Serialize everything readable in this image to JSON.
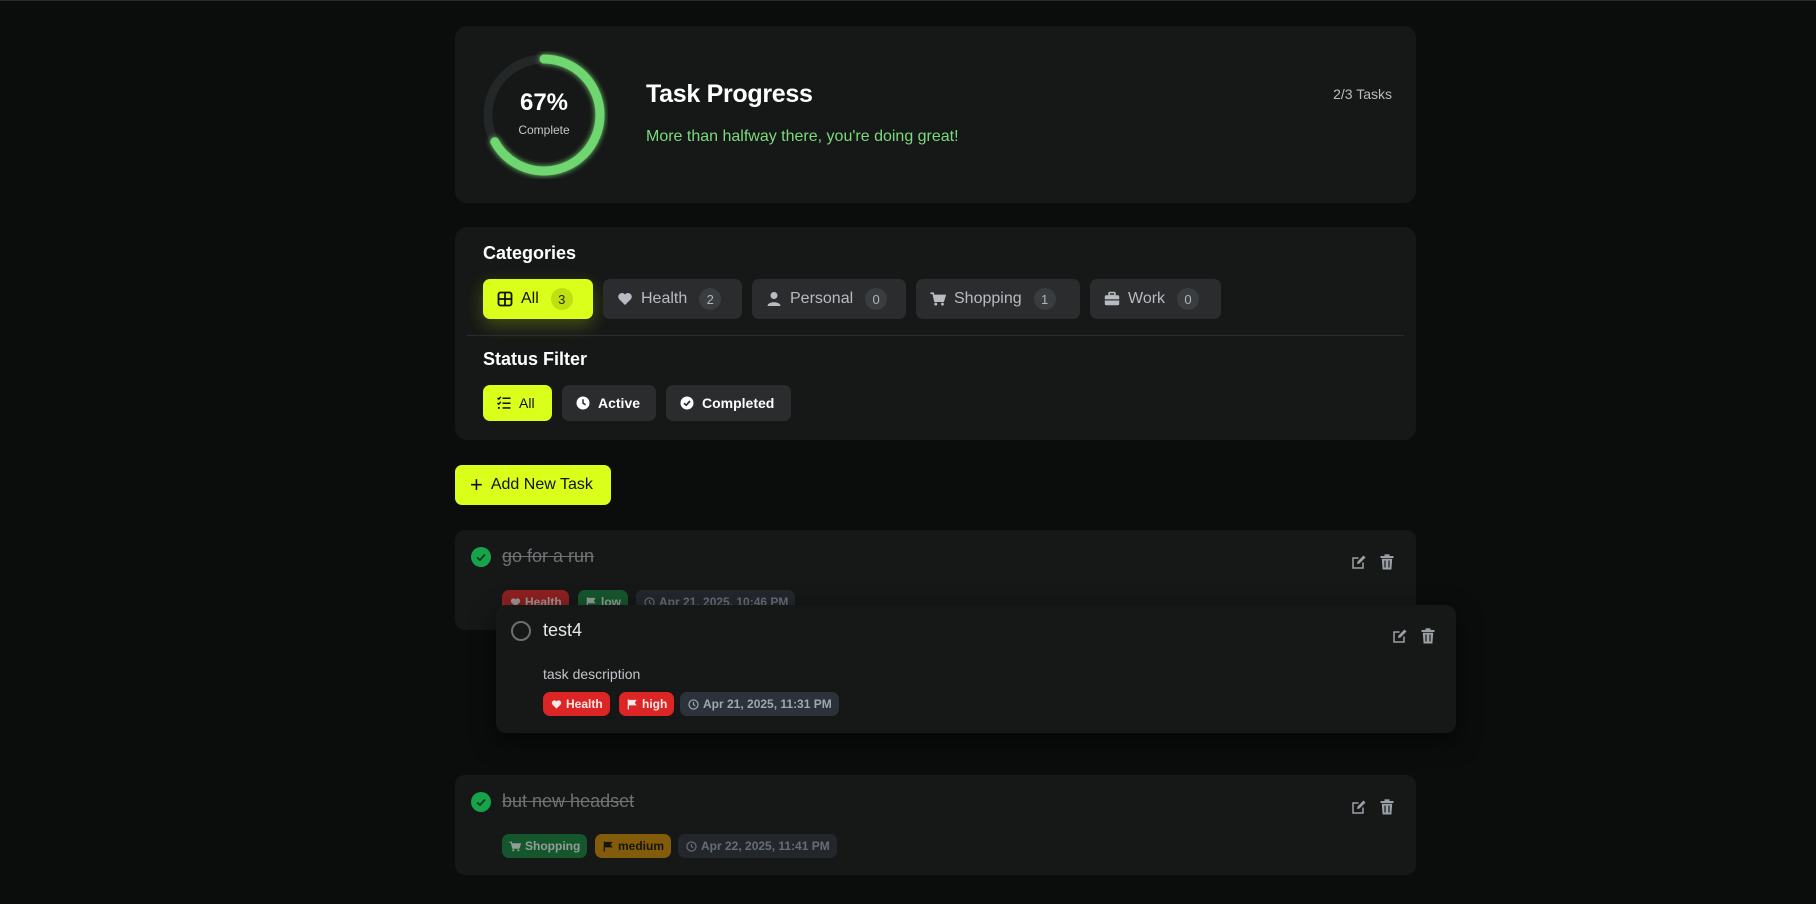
{
  "colors": {
    "accent": "#d9ff1a",
    "progress": "#6fd66f",
    "danger": "#dc2626",
    "success": "#16a34a",
    "warning": "#ca8a04"
  },
  "progress": {
    "percent_label": "67%",
    "percent_value": 67,
    "sub_label": "Complete",
    "title": "Task Progress",
    "message": "More than halfway there, you're doing great!",
    "count_label": "2/3 Tasks"
  },
  "categories": {
    "title": "Categories",
    "items": [
      {
        "label": "All",
        "count": "3",
        "icon": "grid-icon",
        "active": true
      },
      {
        "label": "Health",
        "count": "2",
        "icon": "heart-icon",
        "active": false
      },
      {
        "label": "Personal",
        "count": "0",
        "icon": "user-icon",
        "active": false
      },
      {
        "label": "Shopping",
        "count": "1",
        "icon": "cart-icon",
        "active": false
      },
      {
        "label": "Work",
        "count": "0",
        "icon": "briefcase-icon",
        "active": false
      }
    ]
  },
  "status_filter": {
    "title": "Status Filter",
    "items": [
      {
        "label": "All",
        "icon": "list-check-icon",
        "active": true
      },
      {
        "label": "Active",
        "icon": "clock-icon",
        "active": false
      },
      {
        "label": "Completed",
        "icon": "check-circle-icon",
        "active": false
      }
    ]
  },
  "add_task_label": "Add New Task",
  "tasks": [
    {
      "title": "go for a run",
      "completed": true,
      "description": "",
      "category": "Health",
      "priority": "low",
      "date": "Apr 21, 2025, 10:46 PM"
    },
    {
      "title": "test4",
      "completed": false,
      "description": "task description",
      "category": "Health",
      "priority": "high",
      "date": "Apr 21, 2025, 11:31 PM"
    },
    {
      "title": "but new headset",
      "completed": true,
      "description": "",
      "category": "Shopping",
      "priority": "medium",
      "date": "Apr 22, 2025, 11:41 PM"
    }
  ]
}
